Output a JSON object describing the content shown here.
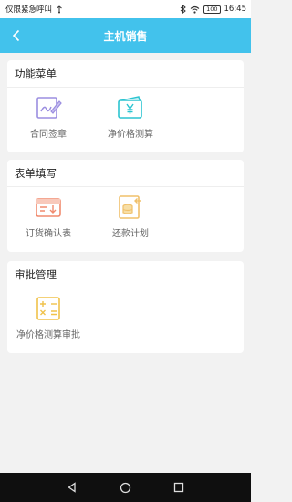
{
  "status_bar": {
    "carrier": "仅限紧急呼叫",
    "battery": "100",
    "time": "16:45"
  },
  "header": {
    "title": "主机销售",
    "back_icon": "chevron-left-icon"
  },
  "sections": [
    {
      "title": "功能菜单",
      "items": [
        {
          "label": "合同签章",
          "icon": "contract-sign-icon",
          "color": "#9b8ee0"
        },
        {
          "label": "净价格测算",
          "icon": "wallet-yen-icon",
          "color": "#2bc4d0"
        }
      ]
    },
    {
      "title": "表单填写",
      "items": [
        {
          "label": "订货确认表",
          "icon": "order-confirm-icon",
          "color": "#f08a6e"
        },
        {
          "label": "还款计划",
          "icon": "repayment-plan-icon",
          "color": "#f0c06a"
        }
      ]
    },
    {
      "title": "审批管理",
      "items": [
        {
          "label": "净价格测算审批",
          "icon": "calculator-icon",
          "color": "#f0c24a"
        }
      ]
    }
  ],
  "colors": {
    "header_bg": "#42c2ec",
    "page_bg": "#f2f2f2",
    "card_bg": "#ffffff"
  }
}
